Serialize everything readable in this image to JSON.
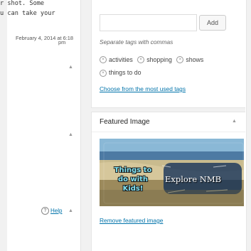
{
  "left": {
    "snippet_line1": "r shot. Some",
    "snippet_line2": "u can take your",
    "date_text": "February 4, 2014 at 6:18",
    "date_pm": "pm",
    "help_label": "Help"
  },
  "tags_box": {
    "add_label": "Add",
    "hint": "Separate tags with commas",
    "tags": [
      "activities",
      "shopping",
      "shows",
      "things to do"
    ],
    "choose_link": "Choose from the most used tags"
  },
  "featured_image": {
    "title": "Featured Image",
    "image_text_things": "Things to do with Kids!",
    "image_text_explore": "Explore NMB",
    "remove_link": "Remove featured image"
  },
  "colors": {
    "link": "#0073aa",
    "panel_bg": "#ffffff",
    "page_bg": "#f1f1f1"
  }
}
